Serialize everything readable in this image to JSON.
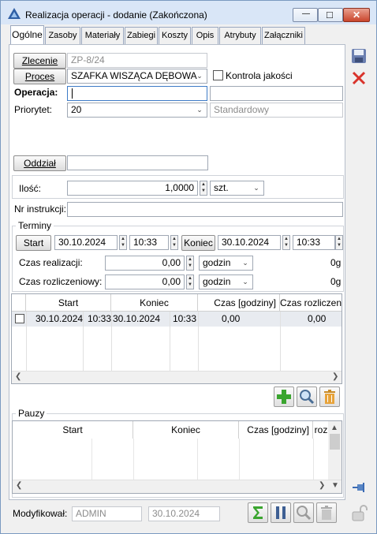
{
  "window": {
    "title": "Realizacja operacji - dodanie (Zakończona)",
    "minimize_glyph": "—",
    "maximize_glyph": "□",
    "close_glyph": "✕"
  },
  "tabs": [
    {
      "label": "Ogólne",
      "active": true
    },
    {
      "label": "Zasoby"
    },
    {
      "label": "Materiały"
    },
    {
      "label": "Zabiegi"
    },
    {
      "label": "Koszty"
    },
    {
      "label": "Opis"
    },
    {
      "label": "Atrybuty"
    },
    {
      "label": "Załączniki"
    }
  ],
  "form": {
    "zlecenie_button": "Zlecenie",
    "zlecenie_value": "ZP-8/24",
    "proces_button": "Proces",
    "proces_value": "SZAFKA WISZĄCA DĘBOWA",
    "kontrola_label": "Kontrola jakości",
    "operacja_label": "Operacja:",
    "operacja_value": "",
    "operacja_desc": "",
    "priorytet_label": "Priorytet:",
    "priorytet_value": "20",
    "priorytet_desc": "Standardowy",
    "oddzial_button": "Oddział",
    "oddzial_value": "",
    "ilosc_label": "Ilość:",
    "ilosc_value": "1,0000",
    "ilosc_unit": "szt.",
    "nr_instrukcji_label": "Nr instrukcji:",
    "nr_instrukcji_value": ""
  },
  "terminy": {
    "title": "Terminy",
    "start_button": "Start",
    "start_date": "30.10.2024",
    "start_time": "10:33",
    "koniec_button": "Koniec",
    "koniec_date": "30.10.2024",
    "koniec_time": "10:33",
    "czas_realizacji_label": "Czas realizacji:",
    "czas_realizacji_value": "0,00",
    "czas_realizacji_unit": "godzin",
    "czas_realizacji_extra": "0g",
    "czas_rozliczeniowy_label": "Czas rozliczeniowy:",
    "czas_rozliczeniowy_value": "0,00",
    "czas_rozliczeniowy_unit": "godzin",
    "czas_rozliczeniowy_extra": "0g"
  },
  "realizacje_grid": {
    "headers": [
      "Start",
      "Koniec",
      "Czas [godziny]",
      "Czas rozliczenio"
    ],
    "rows": [
      {
        "start_date": "30.10.2024",
        "start_time": "10:33",
        "end_date": "30.10.2024",
        "end_time": "10:33",
        "czas": "0,00",
        "czas_rozl": "0,00"
      }
    ]
  },
  "pauzy": {
    "title": "Pauzy",
    "headers": [
      "Start",
      "Koniec",
      "Czas [godziny]",
      "roz"
    ]
  },
  "footer": {
    "modyfikowal_label": "Modyfikował:",
    "modyfikowal_user": "ADMIN",
    "modyfikowal_date": "30.10.2024"
  },
  "colors": {
    "accent": "#3b6bb4",
    "save_icon": "#6b7fb0",
    "cancel_icon": "#d9332b",
    "add_icon": "#3aa52f"
  }
}
